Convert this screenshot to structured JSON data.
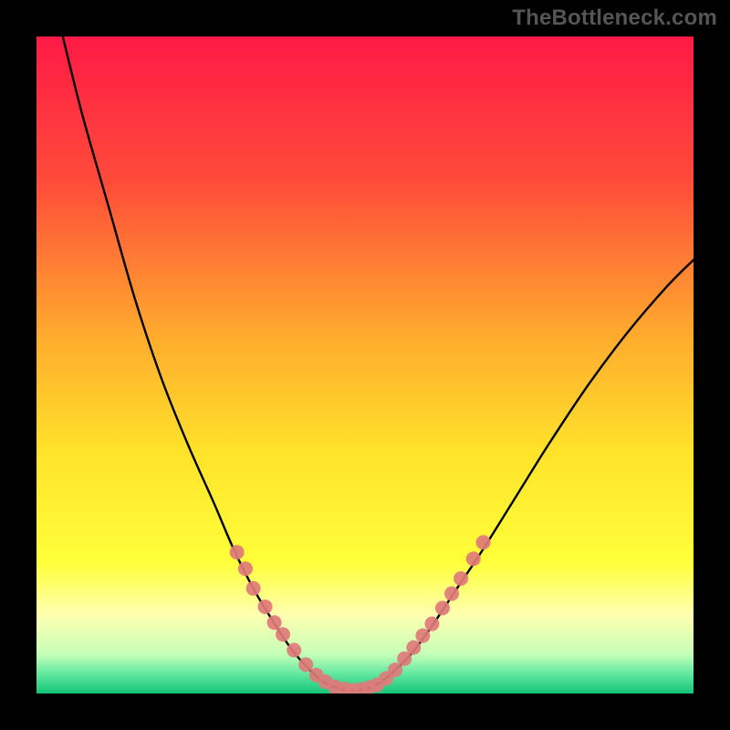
{
  "watermark": "TheBottleneck.com",
  "chart_data": {
    "type": "line",
    "title": "",
    "xlabel": "",
    "ylabel": "",
    "xlim": [
      0,
      100
    ],
    "ylim": [
      0,
      100
    ],
    "grid": false,
    "legend": false,
    "background_gradient": {
      "stops": [
        {
          "offset": 0.0,
          "color": "#ff1a46"
        },
        {
          "offset": 0.22,
          "color": "#ff4b3a"
        },
        {
          "offset": 0.45,
          "color": "#ffa92e"
        },
        {
          "offset": 0.63,
          "color": "#ffe22a"
        },
        {
          "offset": 0.8,
          "color": "#ffff3a"
        },
        {
          "offset": 0.88,
          "color": "#ffffb0"
        },
        {
          "offset": 0.94,
          "color": "#c6ffb8"
        },
        {
          "offset": 0.97,
          "color": "#62e8a0"
        },
        {
          "offset": 1.0,
          "color": "#16c47a"
        }
      ]
    },
    "series": [
      {
        "name": "curve",
        "is_curve": true,
        "stroke": "#000000",
        "values": [
          {
            "x": 4,
            "y": 100
          },
          {
            "x": 7,
            "y": 88
          },
          {
            "x": 11,
            "y": 74
          },
          {
            "x": 15,
            "y": 60
          },
          {
            "x": 19,
            "y": 48
          },
          {
            "x": 23,
            "y": 38
          },
          {
            "x": 27,
            "y": 29
          },
          {
            "x": 30,
            "y": 22
          },
          {
            "x": 33,
            "y": 16
          },
          {
            "x": 36,
            "y": 11
          },
          {
            "x": 39,
            "y": 6.5
          },
          {
            "x": 42,
            "y": 3.2
          },
          {
            "x": 44,
            "y": 1.6
          },
          {
            "x": 46,
            "y": 0.8
          },
          {
            "x": 48,
            "y": 0.5
          },
          {
            "x": 50,
            "y": 0.7
          },
          {
            "x": 52,
            "y": 1.5
          },
          {
            "x": 54,
            "y": 3.0
          },
          {
            "x": 57,
            "y": 6.0
          },
          {
            "x": 60,
            "y": 10
          },
          {
            "x": 64,
            "y": 16
          },
          {
            "x": 68,
            "y": 22
          },
          {
            "x": 73,
            "y": 30
          },
          {
            "x": 78,
            "y": 38
          },
          {
            "x": 84,
            "y": 47
          },
          {
            "x": 90,
            "y": 55
          },
          {
            "x": 96,
            "y": 62
          },
          {
            "x": 100,
            "y": 66
          }
        ]
      },
      {
        "name": "points-left",
        "is_curve": false,
        "fill": "#e07a7a",
        "values": [
          {
            "x": 30.5,
            "y": 21.5
          },
          {
            "x": 31.8,
            "y": 19.0
          },
          {
            "x": 33.0,
            "y": 16.0
          },
          {
            "x": 34.8,
            "y": 13.2
          },
          {
            "x": 36.2,
            "y": 10.8
          },
          {
            "x": 37.5,
            "y": 9.0
          },
          {
            "x": 39.2,
            "y": 6.6
          },
          {
            "x": 41.0,
            "y": 4.4
          },
          {
            "x": 42.6,
            "y": 2.8
          },
          {
            "x": 44.0,
            "y": 1.8
          }
        ]
      },
      {
        "name": "points-flat",
        "is_curve": false,
        "fill": "#e07a7a",
        "values": [
          {
            "x": 45.4,
            "y": 1.0
          },
          {
            "x": 46.8,
            "y": 0.7
          },
          {
            "x": 48.0,
            "y": 0.5
          },
          {
            "x": 49.3,
            "y": 0.6
          },
          {
            "x": 50.6,
            "y": 0.9
          },
          {
            "x": 51.8,
            "y": 1.3
          }
        ]
      },
      {
        "name": "points-right",
        "is_curve": false,
        "fill": "#e07a7a",
        "values": [
          {
            "x": 53.2,
            "y": 2.3
          },
          {
            "x": 54.6,
            "y": 3.6
          },
          {
            "x": 56.0,
            "y": 5.3
          },
          {
            "x": 57.4,
            "y": 7.0
          },
          {
            "x": 58.8,
            "y": 8.8
          },
          {
            "x": 60.2,
            "y": 10.6
          },
          {
            "x": 61.8,
            "y": 13.0
          },
          {
            "x": 63.2,
            "y": 15.2
          },
          {
            "x": 64.6,
            "y": 17.5
          },
          {
            "x": 66.5,
            "y": 20.5
          },
          {
            "x": 68.0,
            "y": 23.0
          }
        ]
      }
    ]
  }
}
